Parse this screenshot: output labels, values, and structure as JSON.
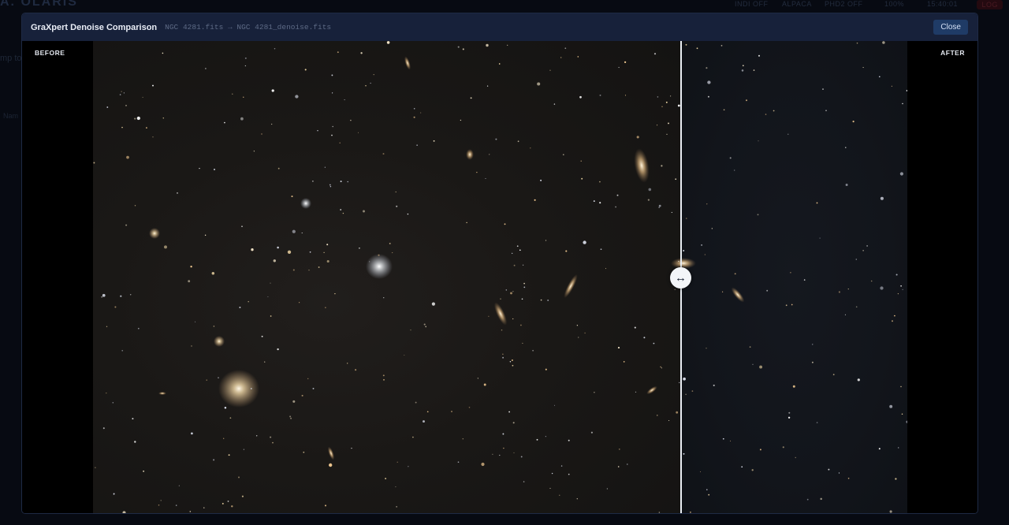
{
  "background": {
    "brand": "A.  OLARIS",
    "topbar_items": [
      "INDI OFF",
      "ALPACA",
      "PHD2 OFF",
      "100%",
      "15:40:01"
    ],
    "log_label": "LOG",
    "side_text": "mp to",
    "name_header": "Nam"
  },
  "modal": {
    "title": "GraXpert Denoise Comparison",
    "subtitle": "NGC 4281.fits → NGC 4281_denoise.fits",
    "close_label": "Close",
    "before_label": "BEFORE",
    "after_label": "AFTER",
    "handle_glyph": "↔",
    "split_fraction": 0.72
  }
}
